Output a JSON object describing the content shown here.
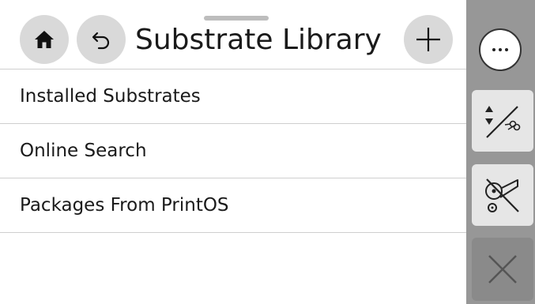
{
  "header": {
    "title": "Substrate Library",
    "home_icon": "home-icon",
    "back_icon": "back-arrow-icon",
    "add_icon": "plus-icon"
  },
  "list": {
    "items": [
      {
        "label": "Installed Substrates"
      },
      {
        "label": "Online Search"
      },
      {
        "label": "Packages From PrintOS"
      }
    ]
  },
  "sidebar": {
    "menu_icon": "more-options-icon",
    "buttons": [
      {
        "icon": "form-feed-and-cut-icon"
      },
      {
        "icon": "unload-roll-icon"
      },
      {
        "icon": "close-icon"
      }
    ]
  },
  "colors": {
    "sidebar_bg": "#979797",
    "button_bg": "#d9d9d9",
    "divider": "#cfcfcf"
  }
}
